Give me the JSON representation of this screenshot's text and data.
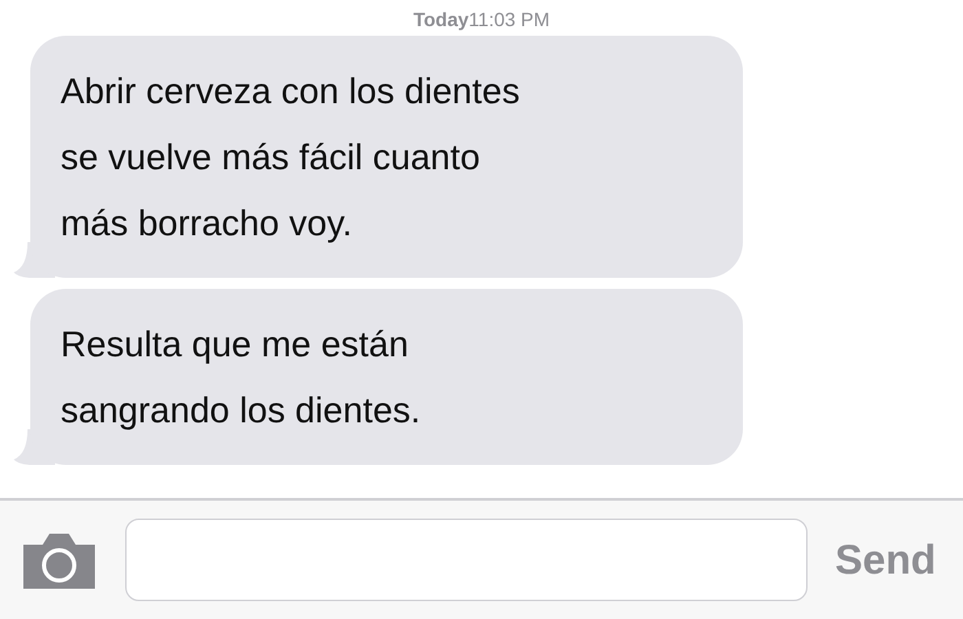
{
  "timestamp": "**Today**11:03 PM",
  "messages": [
    {
      "text": "Abrir cerveza con los dientes\nse vuelve más fácil cuanto\nmás borracho voy.",
      "tail": true
    },
    {
      "text": "Resulta que me están\nsangrando los dientes.",
      "tail": true
    }
  ],
  "composer": {
    "send": "Send"
  }
}
